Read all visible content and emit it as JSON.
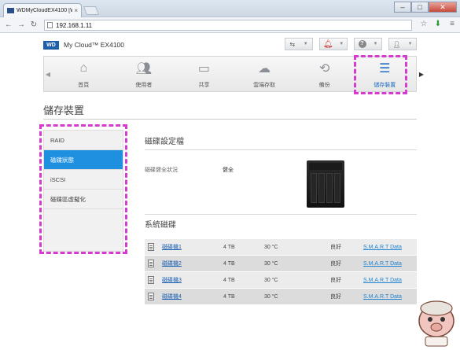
{
  "browser": {
    "tab_title": "WDMyCloudEX4100 [W",
    "url": "192.168.1.11",
    "win_min": "–",
    "win_max": "□",
    "win_close": "✕"
  },
  "app": {
    "logo": "WD",
    "name": "My Cloud™ EX4100"
  },
  "nav": {
    "items": [
      {
        "label": "首頁",
        "icon": "home-icon"
      },
      {
        "label": "使用者",
        "icon": "users-icon"
      },
      {
        "label": "共享",
        "icon": "folder-icon"
      },
      {
        "label": "雲端存取",
        "icon": "cloud-icon"
      },
      {
        "label": "備份",
        "icon": "backup-icon"
      },
      {
        "label": "儲存裝置",
        "icon": "storage-icon"
      }
    ],
    "active_index": 5
  },
  "page": {
    "title": "儲存裝置"
  },
  "sidebar": {
    "items": [
      {
        "label": "RAID"
      },
      {
        "label": "磁碟狀態"
      },
      {
        "label": "iSCSI"
      },
      {
        "label": "磁碟區虛擬化"
      }
    ],
    "active_index": 1
  },
  "disk_profile": {
    "heading": "磁碟設定檔",
    "health_label": "磁碟健全狀況",
    "health_value": "健全"
  },
  "system_disks": {
    "heading": "系統磁碟",
    "rows": [
      {
        "name": "磁碟機1",
        "size": "4 TB",
        "temp": "30 °C",
        "status": "良好",
        "smart": "S.M.A.R.T Data"
      },
      {
        "name": "磁碟機2",
        "size": "4 TB",
        "temp": "30 °C",
        "status": "良好",
        "smart": "S.M.A.R.T Data"
      },
      {
        "name": "磁碟機3",
        "size": "4 TB",
        "temp": "30 °C",
        "status": "良好",
        "smart": "S.M.A.R.T Data"
      },
      {
        "name": "磁碟機4",
        "size": "4 TB",
        "temp": "30 °C",
        "status": "良好",
        "smart": "S.M.A.R.T Data"
      }
    ]
  },
  "colors": {
    "highlight": "#d63bd0",
    "accent": "#1f8fe0",
    "link": "#1b5fb2"
  }
}
